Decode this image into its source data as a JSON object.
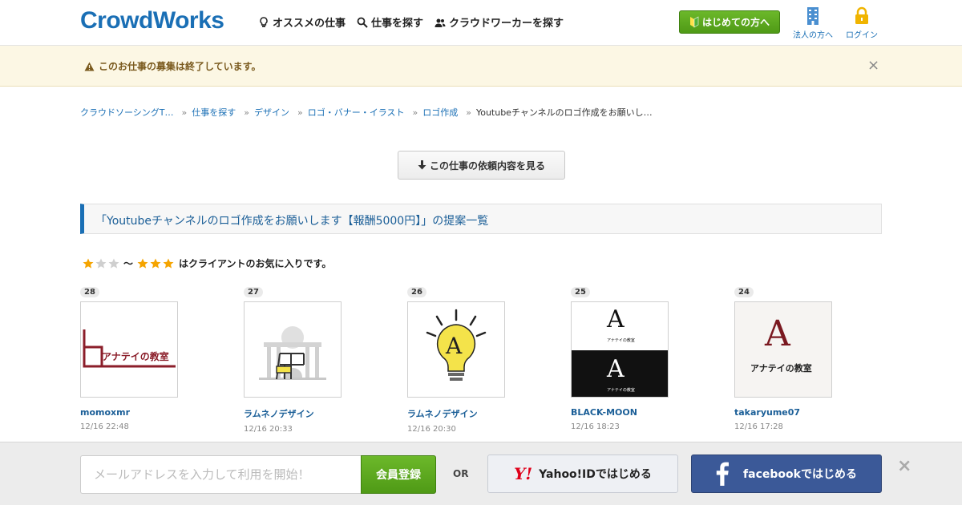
{
  "header": {
    "logo": "CrowdWorks",
    "nav": [
      {
        "label": "オススメの仕事",
        "icon": "lightbulb-icon"
      },
      {
        "label": "仕事を探す",
        "icon": "search-icon"
      },
      {
        "label": "クラウドワーカーを探す",
        "icon": "users-icon"
      }
    ],
    "first_time_label": "はじめての方へ",
    "corporate_label": "法人の方へ",
    "login_label": "ログイン"
  },
  "notice": {
    "text": "このお仕事の募集は終了しています。",
    "close": "×"
  },
  "breadcrumb": [
    "クラウドソーシングT…",
    "仕事を探す",
    "デザイン",
    "ロゴ・バナー・イラスト",
    "ロゴ作成"
  ],
  "breadcrumb_current": "Youtubeチャンネルのロゴ作成をお願いし…",
  "breadcrumb_sep": "»",
  "view_job_label": "この仕事の依頼内容を見る",
  "section_title": "「Youtubeチャンネルのロゴ作成をお願いします【報酬5000円】」の提案一覧",
  "favorite_note": {
    "separator": "〜",
    "text": "はクライアントのお気に入りです。"
  },
  "proposals": [
    {
      "number": "28",
      "user": "momoxmr",
      "date": "12/16 22:48",
      "thumb_text": "アナテイの教室"
    },
    {
      "number": "27",
      "user": "ラムネノデザイン",
      "date": "12/16 20:33"
    },
    {
      "number": "26",
      "user": "ラムネノデザイン",
      "date": "12/16 20:30",
      "thumb_text": "A"
    },
    {
      "number": "25",
      "user": "BLACK-MOON",
      "date": "12/16 18:23",
      "thumb_text": "A",
      "thumb_sub": "アナテイの教室"
    },
    {
      "number": "24",
      "user": "takaryume07",
      "date": "12/16 17:28",
      "thumb_text": "A",
      "thumb_sub": "アナテイの教室"
    }
  ],
  "signup": {
    "email_placeholder": "メールアドレスを入力して利用を開始！",
    "register_label": "会員登録",
    "or": "OR",
    "yahoo_logo": "Y!",
    "yahoo_label": "Yahoo!IDではじめる",
    "facebook_label": "facebookではじめる",
    "close": "×"
  },
  "colors": {
    "brand_blue": "#1a6fb5",
    "green": "#5aa71c",
    "facebook": "#3b5998",
    "notice_bg": "#fcf7e4"
  }
}
